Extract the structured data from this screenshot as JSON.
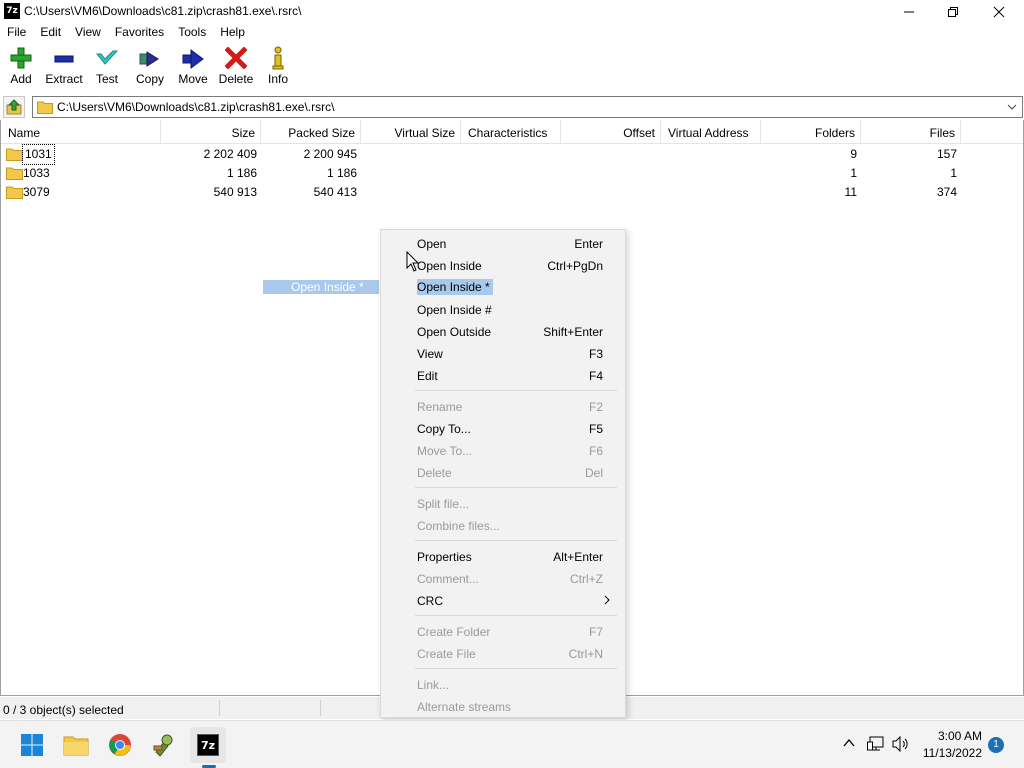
{
  "window": {
    "app_icon_text": "7z",
    "title": "C:\\Users\\VM6\\Downloads\\c81.zip\\crash81.exe\\.rsrc\\"
  },
  "menu": [
    "File",
    "Edit",
    "View",
    "Favorites",
    "Tools",
    "Help"
  ],
  "toolbar": {
    "add": "Add",
    "extract": "Extract",
    "test": "Test",
    "copy": "Copy",
    "move": "Move",
    "delete": "Delete",
    "info": "Info"
  },
  "address": {
    "path": "C:\\Users\\VM6\\Downloads\\c81.zip\\crash81.exe\\.rsrc\\"
  },
  "columns": [
    "Name",
    "Size",
    "Packed Size",
    "Virtual Size",
    "Characteristics",
    "Offset",
    "Virtual Address",
    "Folders",
    "Files"
  ],
  "rows": [
    {
      "name": "1031",
      "size": "2 202 409",
      "packed": "2 200 945",
      "folders": "9",
      "files": "157"
    },
    {
      "name": "1033",
      "size": "1 186",
      "packed": "1 186",
      "folders": "1",
      "files": "1"
    },
    {
      "name": "3079",
      "size": "540 913",
      "packed": "540 413",
      "folders": "11",
      "files": "374"
    }
  ],
  "status": {
    "selection": "0 / 3 object(s) selected"
  },
  "drag_ghost": "Open Inside *",
  "context_menu": {
    "open": {
      "label": "Open",
      "shortcut": "Enter"
    },
    "open_inside": {
      "label": "Open Inside",
      "shortcut": "Ctrl+PgDn"
    },
    "open_inside_star": {
      "label": "Open Inside *"
    },
    "open_inside_hash": {
      "label": "Open Inside #"
    },
    "open_outside": {
      "label": "Open Outside",
      "shortcut": "Shift+Enter"
    },
    "view": {
      "label": "View",
      "shortcut": "F3"
    },
    "edit": {
      "label": "Edit",
      "shortcut": "F4"
    },
    "rename": {
      "label": "Rename",
      "shortcut": "F2"
    },
    "copy_to": {
      "label": "Copy To...",
      "shortcut": "F5"
    },
    "move_to": {
      "label": "Move To...",
      "shortcut": "F6"
    },
    "delete": {
      "label": "Delete",
      "shortcut": "Del"
    },
    "split_file": {
      "label": "Split file..."
    },
    "combine_files": {
      "label": "Combine files..."
    },
    "properties": {
      "label": "Properties",
      "shortcut": "Alt+Enter"
    },
    "comment": {
      "label": "Comment...",
      "shortcut": "Ctrl+Z"
    },
    "crc": {
      "label": "CRC"
    },
    "create_folder": {
      "label": "Create Folder",
      "shortcut": "F7"
    },
    "create_file": {
      "label": "Create File",
      "shortcut": "Ctrl+N"
    },
    "link": {
      "label": "Link..."
    },
    "alternate_streams": {
      "label": "Alternate streams"
    }
  },
  "taskbar": {
    "clock_time": "3:00 AM",
    "clock_date": "11/13/2022",
    "notification_count": "1",
    "active_app_label": "7z"
  },
  "colors": {
    "highlight": "#a8c8ec",
    "accent": "#1a6fb5",
    "disabled_text": "#9a9a9a"
  }
}
